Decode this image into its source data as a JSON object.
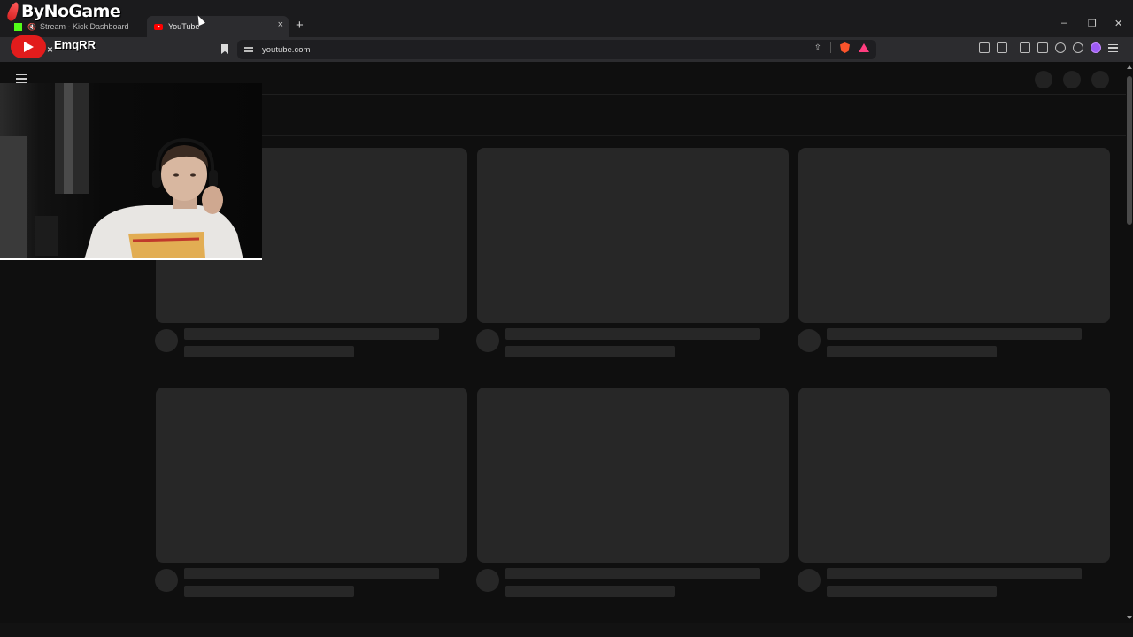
{
  "overlay": {
    "logo_text": "ByNoGame",
    "channel_name": "EmqRR",
    "channel_separator": "×"
  },
  "tabs": [
    {
      "title": "Stream - Kick Dashboard",
      "active": false
    },
    {
      "title": "YouTube",
      "active": true
    }
  ],
  "new_tab_symbol": "+",
  "tab_close_symbol": "×",
  "window_controls": {
    "minimize": "–",
    "restore": "❐",
    "close": "✕"
  },
  "address_bar": {
    "url": "youtube.com"
  },
  "icons": [
    "kick-favicon",
    "youtube-favicon",
    "audio-muted-icon",
    "bookmark-icon",
    "site-info-icon",
    "share-icon",
    "brave-shields-icon",
    "brave-rewards-icon",
    "extensions-icon",
    "tab-search-icon",
    "sidebar-icon",
    "wallet-icon",
    "leo-icon",
    "vpn-icon",
    "profile-icon",
    "menu-icon",
    "hamburger-icon"
  ],
  "colors": {
    "background": "#0f0f0f",
    "skeleton": "#272727",
    "youtube_red": "#ff0000",
    "kick_green": "#53fc18",
    "brave_orange": "#fb542b"
  }
}
